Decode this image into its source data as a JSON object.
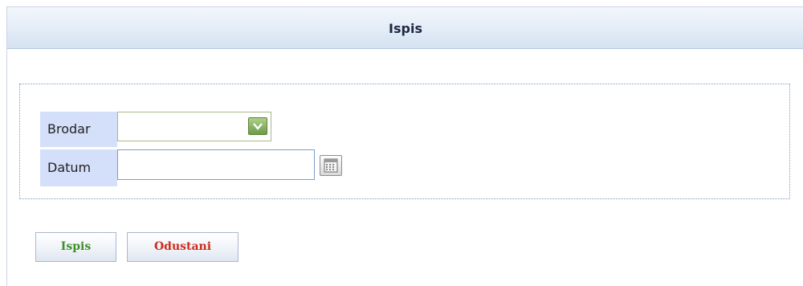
{
  "window": {
    "title": "Ispis"
  },
  "form": {
    "brodar": {
      "label": "Brodar",
      "value": ""
    },
    "datum": {
      "label": "Datum",
      "value": ""
    }
  },
  "actions": {
    "print_label": "Ispis",
    "cancel_label": "Odustani"
  },
  "icons": {
    "dropdown": "chevron-down-icon",
    "calendar": "calendar-icon"
  },
  "colors": {
    "label_bg": "#d4e0fa",
    "print_text": "#3f8f2a",
    "cancel_text": "#cc2d1e",
    "dropdown_button": "#8db86a"
  }
}
